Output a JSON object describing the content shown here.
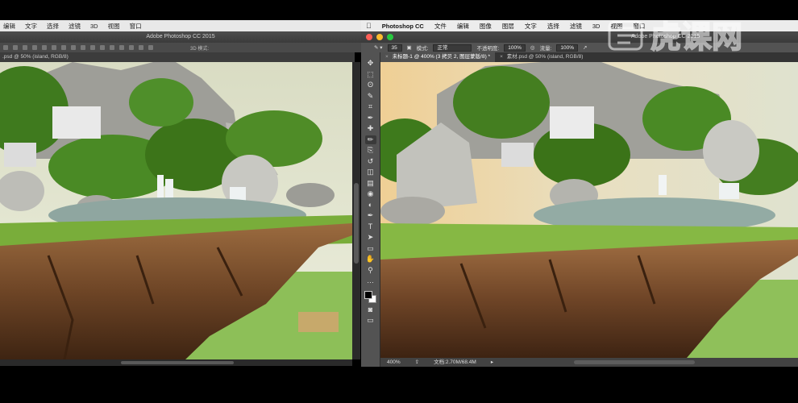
{
  "menubar_left": {
    "items": [
      "编辑",
      "文字",
      "选择",
      "滤镜",
      "3D",
      "视图",
      "窗口"
    ]
  },
  "menubar_right": {
    "app_name": "Photoshop CC",
    "items": [
      "文件",
      "编辑",
      "图像",
      "图层",
      "文字",
      "选择",
      "滤镜",
      "3D",
      "视图",
      "窗口"
    ]
  },
  "window_left": {
    "title": "Adobe Photoshop CC 2015",
    "options_label": "3D 模式:",
    "doc_tab": ".psd @ 50% (island, RGB/8)"
  },
  "window_right": {
    "title": "Adobe Photoshop CC 2015",
    "options": {
      "brush_size": "35",
      "mode_label": "模式:",
      "mode_value": "正常",
      "opacity_label": "不透明度:",
      "opacity_value": "100%",
      "flow_label": "流量:",
      "flow_value": "100%"
    },
    "tabs": [
      {
        "label": "未标题-1 @ 400% (3 拷贝 2, 图层蒙版/8) *"
      },
      {
        "label": "素材.psd @ 50% (island, RGB/8)"
      }
    ],
    "status": {
      "zoom": "400%",
      "doc_info": "文档:2.70M/68.4M"
    }
  },
  "toolbox": {
    "tools": [
      "move-tool-icon",
      "marquee-tool-icon",
      "lasso-tool-icon",
      "quick-select-tool-icon",
      "crop-tool-icon",
      "eyedropper-tool-icon",
      "healing-tool-icon",
      "brush-tool-icon",
      "clone-stamp-tool-icon",
      "history-brush-tool-icon",
      "eraser-tool-icon",
      "gradient-tool-icon",
      "blur-tool-icon",
      "dodge-tool-icon",
      "pen-tool-icon",
      "type-tool-icon",
      "path-select-tool-icon",
      "shape-tool-icon",
      "hand-tool-icon",
      "zoom-tool-icon",
      "more-tools-icon"
    ],
    "glyphs": [
      "✥",
      "⬚",
      "ʘ",
      "✎",
      "⌗",
      "✒",
      "✚",
      "✏",
      "⎘",
      "↺",
      "◫",
      "▤",
      "◉",
      "◐",
      "✒",
      "T",
      "➤",
      "▭",
      "✋",
      "⚲",
      "…"
    ],
    "selected_index": 7
  },
  "watermark": {
    "text": "虎课网"
  },
  "colors": {
    "menubar_bg": "#ececec",
    "panel_bg": "#535353",
    "dark_bg": "#2a2a2a",
    "sky": "#dfe3cf",
    "grass": "#7fb23e",
    "rock": "#8a5a32"
  }
}
